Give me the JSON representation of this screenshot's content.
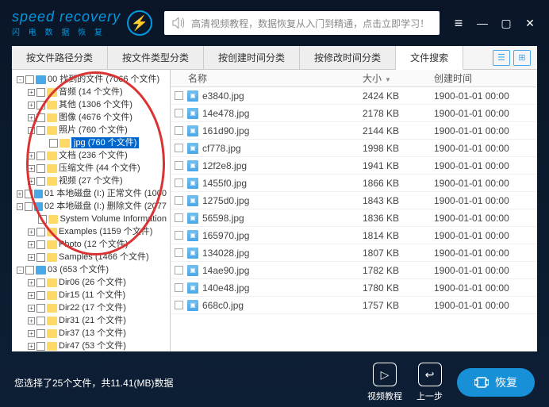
{
  "logo": {
    "main": "speed recovery",
    "sub": "闪 电 数 据 恢 复",
    "bolt": "⚡"
  },
  "banner": {
    "text": "高清视频教程，数据恢复从入门到精通，点击立即学习！"
  },
  "tabs": [
    {
      "label": "按文件路径分类",
      "active": false
    },
    {
      "label": "按文件类型分类",
      "active": false
    },
    {
      "label": "按创建时间分类",
      "active": false
    },
    {
      "label": "按修改时间分类",
      "active": false
    },
    {
      "label": "文件搜索",
      "active": true
    }
  ],
  "tree": [
    {
      "indent": 0,
      "toggle": "-",
      "blue": true,
      "label": "00 找到的文件 (7066 个文件)"
    },
    {
      "indent": 1,
      "toggle": "+",
      "label": "音频  (14 个文件)"
    },
    {
      "indent": 1,
      "toggle": "+",
      "label": "其他  (1306 个文件)"
    },
    {
      "indent": 1,
      "toggle": "+",
      "label": "图像  (4676 个文件)"
    },
    {
      "indent": 1,
      "toggle": "-",
      "label": "照片  (760 个文件)"
    },
    {
      "indent": 2,
      "toggle": "",
      "label": "jpg  (760 个文件)",
      "highlight": true
    },
    {
      "indent": 1,
      "toggle": "+",
      "label": "文档  (236 个文件)"
    },
    {
      "indent": 1,
      "toggle": "+",
      "label": "压缩文件  (44 个文件)"
    },
    {
      "indent": 1,
      "toggle": "+",
      "label": "视频  (27 个文件)"
    },
    {
      "indent": 0,
      "toggle": "+",
      "blue": true,
      "label": "01 本地磁盘 (I:) 正常文件 (1000"
    },
    {
      "indent": 0,
      "toggle": "-",
      "blue": true,
      "label": "02 本地磁盘 (I:) 删除文件 (2077"
    },
    {
      "indent": 1,
      "toggle": "",
      "label": "System Volume Information"
    },
    {
      "indent": 1,
      "toggle": "+",
      "label": "Examples  (1159 个文件)"
    },
    {
      "indent": 1,
      "toggle": "+",
      "label": "Photo  (12 个文件)"
    },
    {
      "indent": 1,
      "toggle": "+",
      "label": "Samples  (1466 个文件)"
    },
    {
      "indent": 0,
      "toggle": "-",
      "blue": true,
      "label": "03  (653 个文件)"
    },
    {
      "indent": 1,
      "toggle": "+",
      "label": "Dir06  (26 个文件)"
    },
    {
      "indent": 1,
      "toggle": "+",
      "label": "Dir15  (11 个文件)"
    },
    {
      "indent": 1,
      "toggle": "+",
      "label": "Dir22  (17 个文件)"
    },
    {
      "indent": 1,
      "toggle": "+",
      "label": "Dir31  (21 个文件)"
    },
    {
      "indent": 1,
      "toggle": "+",
      "label": "Dir37  (13 个文件)"
    },
    {
      "indent": 1,
      "toggle": "+",
      "label": "Dir47  (53 个文件)"
    }
  ],
  "list": {
    "headers": {
      "name": "名称",
      "size": "大小",
      "date": "创建时间"
    },
    "rows": [
      {
        "name": "e3840.jpg",
        "size": "2424 KB",
        "date": "1900-01-01  00:00"
      },
      {
        "name": "14e478.jpg",
        "size": "2178 KB",
        "date": "1900-01-01  00:00"
      },
      {
        "name": "161d90.jpg",
        "size": "2144 KB",
        "date": "1900-01-01  00:00"
      },
      {
        "name": "cf778.jpg",
        "size": "1998 KB",
        "date": "1900-01-01  00:00"
      },
      {
        "name": "12f2e8.jpg",
        "size": "1941 KB",
        "date": "1900-01-01  00:00"
      },
      {
        "name": "1455f0.jpg",
        "size": "1866 KB",
        "date": "1900-01-01  00:00"
      },
      {
        "name": "1275d0.jpg",
        "size": "1843 KB",
        "date": "1900-01-01  00:00"
      },
      {
        "name": "56598.jpg",
        "size": "1836 KB",
        "date": "1900-01-01  00:00"
      },
      {
        "name": "165970.jpg",
        "size": "1814 KB",
        "date": "1900-01-01  00:00"
      },
      {
        "name": "134028.jpg",
        "size": "1807 KB",
        "date": "1900-01-01  00:00"
      },
      {
        "name": "14ae90.jpg",
        "size": "1782 KB",
        "date": "1900-01-01  00:00"
      },
      {
        "name": "140e48.jpg",
        "size": "1780 KB",
        "date": "1900-01-01  00:00"
      },
      {
        "name": "668c0.jpg",
        "size": "1757 KB",
        "date": "1900-01-01  00:00"
      }
    ]
  },
  "footer": {
    "status": "您选择了25个文件，共11.41(MB)数据",
    "tutorial": "视频教程",
    "back": "上一步",
    "recover": "恢复"
  }
}
